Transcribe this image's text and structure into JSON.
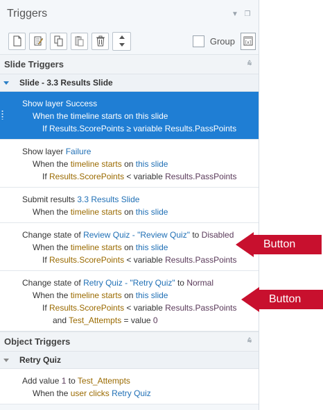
{
  "panel": {
    "title": "Triggers",
    "group_label": "Group"
  },
  "sections": {
    "slide_triggers": "Slide Triggers",
    "object_triggers": "Object Triggers"
  },
  "slide_group": "Slide - 3.3 Results Slide",
  "object_group": "Retry Quiz",
  "triggers": {
    "t1": {
      "l1": [
        "Show layer",
        "Success"
      ],
      "l2": [
        "When the",
        "timeline starts",
        "on",
        "this slide"
      ],
      "l3": [
        "If",
        "Results.ScorePoints",
        "≥ variable",
        "Results.PassPoints"
      ]
    },
    "t2": {
      "l1": [
        "Show layer",
        "Failure"
      ],
      "l2": [
        "When the",
        "timeline starts",
        "on",
        "this slide"
      ],
      "l3": [
        "If",
        "Results.ScorePoints",
        "< variable",
        "Results.PassPoints"
      ]
    },
    "t3": {
      "l1": [
        "Submit results",
        "3.3 Results Slide"
      ],
      "l2": [
        "When the",
        "timeline starts",
        "on",
        "this slide"
      ]
    },
    "t4": {
      "l1": [
        "Change state of",
        "Review Quiz - \"Review Quiz\"",
        "to",
        "Disabled"
      ],
      "l2": [
        "When the",
        "timeline starts",
        "on",
        "this slide"
      ],
      "l3": [
        "If",
        "Results.ScorePoints",
        "< variable",
        "Results.PassPoints"
      ]
    },
    "t5": {
      "l1": [
        "Change state of",
        "Retry Quiz - \"Retry Quiz\"",
        "to",
        "Normal"
      ],
      "l2": [
        "When the",
        "timeline starts",
        "on",
        "this slide"
      ],
      "l3": [
        "If",
        "Results.ScorePoints",
        "< variable",
        "Results.PassPoints"
      ],
      "l4": [
        "and",
        "Test_Attempts",
        "= value",
        "0"
      ]
    },
    "t6": {
      "l1": [
        "Add value",
        "1",
        "to",
        "Test_Attempts"
      ],
      "l2": [
        "When the",
        "user clicks",
        "Retry Quiz"
      ]
    }
  },
  "callouts": [
    "Button",
    "Button"
  ],
  "colors": {
    "selection": "#1f7ed4",
    "link_blue": "#1f6fb5",
    "variable_olive": "#9a6a00",
    "callout_red": "#c8102e"
  },
  "icons": [
    "new-trigger-icon",
    "edit-trigger-icon",
    "copy-icon",
    "paste-icon",
    "delete-icon",
    "move-up-icon",
    "move-down-icon",
    "group-icon",
    "collapse-icon"
  ]
}
